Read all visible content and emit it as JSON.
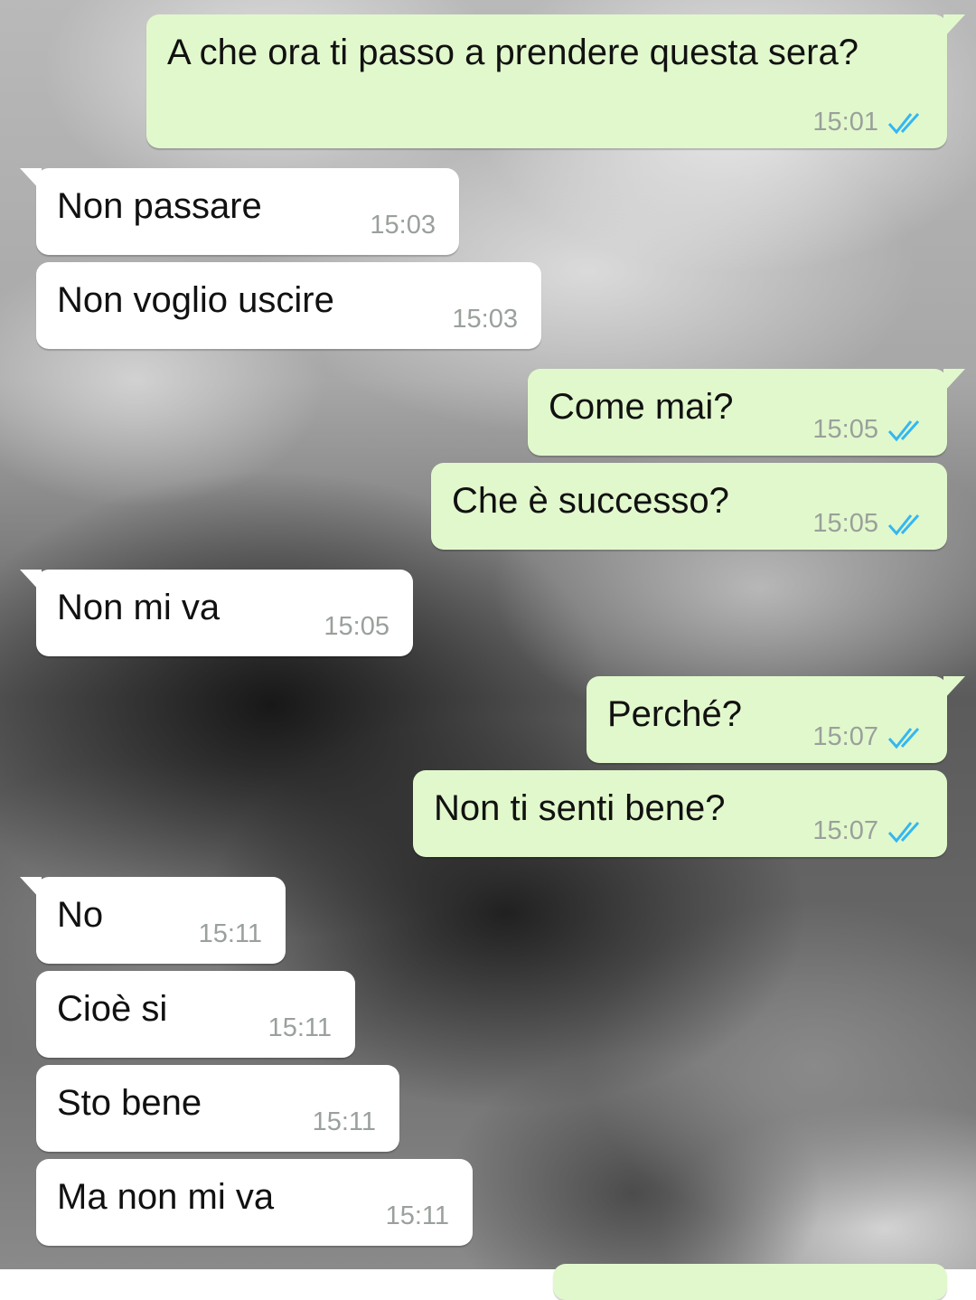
{
  "colors": {
    "incoming_bubble": "#ffffff",
    "outgoing_bubble": "#e1f8cc",
    "read_tick": "#34b7f1"
  },
  "messages": [
    {
      "dir": "out",
      "text": "A che ora ti passo a prendere questa sera?",
      "time": "15:01",
      "status": "read"
    },
    {
      "dir": "in",
      "text": "Non passare",
      "time": "15:03"
    },
    {
      "dir": "in",
      "text": "Non voglio uscire",
      "time": "15:03"
    },
    {
      "dir": "out",
      "text": "Come mai?",
      "time": "15:05",
      "status": "read"
    },
    {
      "dir": "out",
      "text": "Che è successo?",
      "time": "15:05",
      "status": "read"
    },
    {
      "dir": "in",
      "text": "Non mi va",
      "time": "15:05"
    },
    {
      "dir": "out",
      "text": "Perché?",
      "time": "15:07",
      "status": "read"
    },
    {
      "dir": "out",
      "text": "Non ti senti bene?",
      "time": "15:07",
      "status": "read"
    },
    {
      "dir": "in",
      "text": "No",
      "time": "15:11"
    },
    {
      "dir": "in",
      "text": "Cioè si",
      "time": "15:11"
    },
    {
      "dir": "in",
      "text": "Sto bene",
      "time": "15:11"
    },
    {
      "dir": "in",
      "text": "Ma non mi va",
      "time": "15:11"
    }
  ]
}
